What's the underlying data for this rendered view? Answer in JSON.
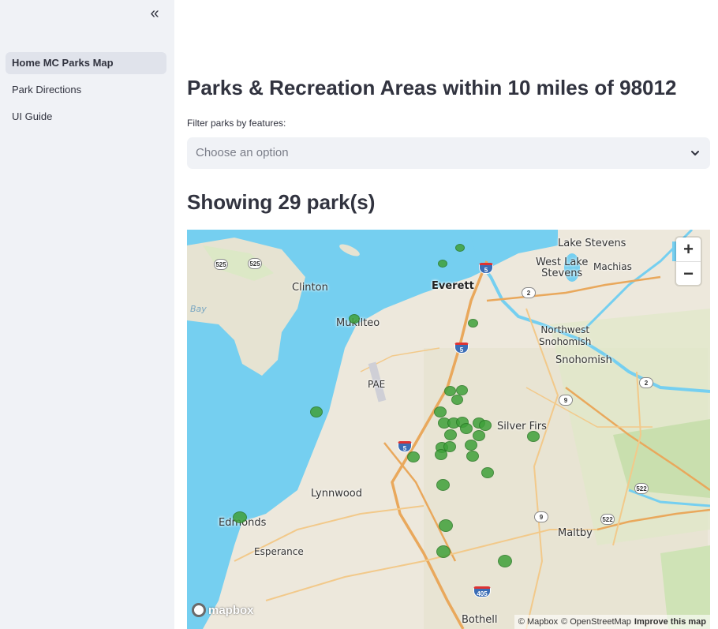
{
  "sidebar": {
    "collapse_icon": "«",
    "items": [
      {
        "label": "Home MC Parks Map",
        "active": true
      },
      {
        "label": "Park Directions",
        "active": false
      },
      {
        "label": "UI Guide",
        "active": false
      }
    ]
  },
  "main": {
    "title": "Parks & Recreation Areas within 10 miles of 98012",
    "filter_label": "Filter parks by features:",
    "filter_placeholder": "Choose an option",
    "count_title": "Showing 29 park(s)"
  },
  "map": {
    "zoom_in": "+",
    "zoom_out": "−",
    "logo_text": "mapbox",
    "attribution": {
      "mapbox": "© Mapbox",
      "osm": "© OpenStreetMap",
      "improve": "Improve this map"
    },
    "labels": {
      "lake_stevens": "Lake Stevens",
      "west_lake_stevens": "West Lake\nStevens",
      "machias": "Machias",
      "clinton": "Clinton",
      "everett": "Everett",
      "mukilteo": "Mukilteo",
      "northwest_snohomish": "Northwest\nSnohomish",
      "snohomish": "Snohomish",
      "pae": "PAE",
      "bay": "Bay",
      "silver_firs": "Silver Firs",
      "lynnwood": "Lynnwood",
      "edmonds": "Edmonds",
      "esperance": "Esperance",
      "maltby": "Maltby",
      "bothell": "Bothell"
    },
    "shields": {
      "s525a": "525",
      "s525b": "525",
      "i5a": "5",
      "i5b": "5",
      "i5c": "5",
      "s2a": "2",
      "s2b": "2",
      "s9a": "9",
      "s9b": "9",
      "s522a": "522",
      "s522b": "522",
      "i405": "405"
    },
    "park_count": 29,
    "colors": {
      "park": "#3fa13a",
      "water": "#75cff0",
      "land": "#ede8dc"
    }
  }
}
